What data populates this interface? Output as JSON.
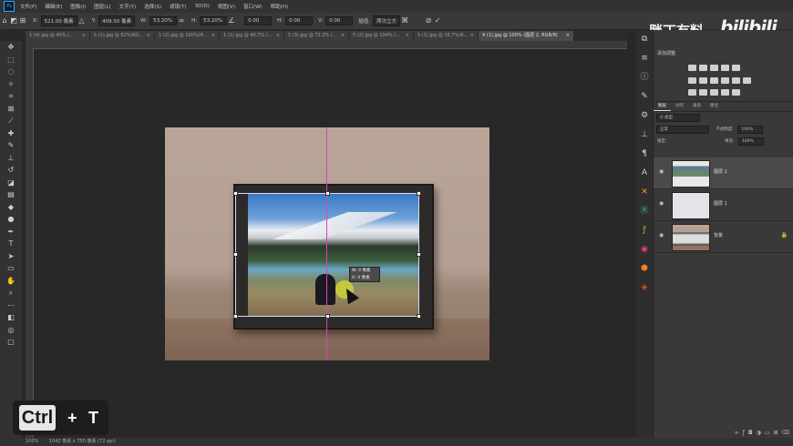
{
  "menu": {
    "items": [
      "文件(F)",
      "编辑(E)",
      "图像(I)",
      "图层(L)",
      "文字(Y)",
      "选择(S)",
      "滤镜(T)",
      "3D(D)",
      "视图(V)",
      "窗口(W)",
      "帮助(H)"
    ]
  },
  "options": {
    "x_label": "X:",
    "x_value": "521.00 像素",
    "y_label": "Y:",
    "y_value": "409.50 像素",
    "w_label": "W:",
    "w_value": "53.20%",
    "h_label": "H:",
    "h_value": "53.20%",
    "angle_value": "0.00",
    "hskew_label": "H:",
    "hskew_value": "0.00",
    "vskew_label": "V:",
    "vskew_value": "0.00",
    "interp_label": "插值:",
    "interp_value": "两次立方"
  },
  "tabs": [
    {
      "label": "1 (4).jpg @ 40% (..."
    },
    {
      "label": "5 (1).jpg @ 62%(RG..."
    },
    {
      "label": "1 (2).jpg @ 100%(R..."
    },
    {
      "label": "1 (1).jpg @ 40.7% (..."
    },
    {
      "label": "5 (3).jpg @ 72.3% (..."
    },
    {
      "label": "5 (2).jpg @ 194% (..."
    },
    {
      "label": "5 (1).jpg @ 16.7%(R..."
    },
    {
      "label": "4 (1).jpg @ 100% (图层 2, RGB/8)"
    }
  ],
  "tooltip": {
    "line1": "W: 0 像素",
    "line2": "H: 0 像素"
  },
  "overlay": {
    "key": "Ctrl",
    "plus": "+",
    "letter": "T"
  },
  "watermark": {
    "cn": "胖丁有料",
    "brand": "bilibili"
  },
  "status": {
    "zoom": "100%",
    "doc_info": "1042 像素 x 750 像素 (72 ppi)"
  },
  "adjust_panel": {
    "title": "添加调整"
  },
  "layers_panel": {
    "tabs": [
      "图层",
      "动作",
      "通道",
      "路径"
    ],
    "kind_filter": "Q 类型",
    "blend_mode": "正常",
    "opacity_label": "不透明度:",
    "opacity_value": "100%",
    "lock_label": "锁定:",
    "fill_label": "填充:",
    "fill_value": "100%",
    "layers": [
      {
        "name": "图层 2",
        "selected": true
      },
      {
        "name": "图层 1",
        "selected": false
      },
      {
        "name": "背景",
        "selected": false
      }
    ]
  },
  "colors": {
    "accent": "#31a8ff",
    "guide": "#e040c0",
    "panel": "#393939",
    "canvas": "#282828"
  }
}
